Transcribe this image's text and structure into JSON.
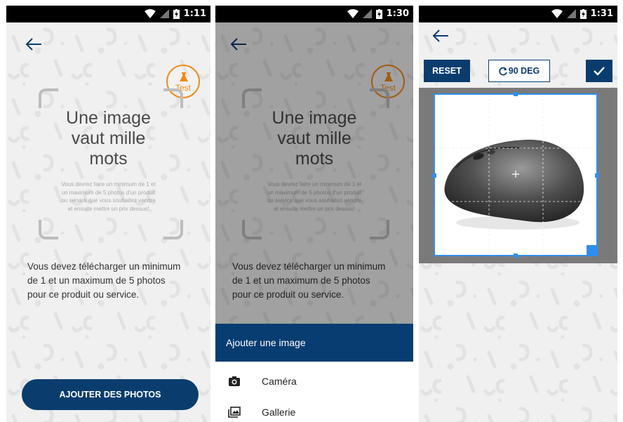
{
  "screen1": {
    "time": "1:11",
    "status_icons": [
      "wifi-icon",
      "signal-icon",
      "battery-icon"
    ],
    "headline": [
      "Une image",
      "vaut mille",
      "mots"
    ],
    "small_text": [
      "Vous devrez faire un minimum de 1 et",
      "un maximum de 5 photos d'un produit",
      "ou service que vous souhaitez vendre",
      "et ensuite mettre un prix dessus!"
    ],
    "test_badge": "Test",
    "instruction": [
      "Vous devez télécharger un minimum",
      "de 1 et un maximum de 5 photos",
      "pour ce produit ou service."
    ],
    "add_button": "AJOUTER DES PHOTOS"
  },
  "screen2": {
    "time": "1:30",
    "headline": [
      "Une image",
      "vaut mille",
      "mots"
    ],
    "small_text": [
      "Vous devrez faire un minimum de 1 et",
      "un maximum de 5 photos d'un produit",
      "ou service que vous souhaitez vendre",
      "et ensuite mettre un prix dessus!"
    ],
    "test_badge": "Test",
    "instruction": [
      "Vous devez télécharger un minimum",
      "de 1 et un maximum de 5 photos",
      "pour ce produit ou service."
    ],
    "sheet_title": "Ajouter une image",
    "sheet_items": [
      {
        "label": "Caméra",
        "icon": "camera-icon"
      },
      {
        "label": "Gallerie",
        "icon": "gallery-icon"
      }
    ]
  },
  "screen3": {
    "time": "1:31",
    "reset_label": "RESET",
    "rotate_label": "90 DEG",
    "confirm_icon": "check-icon",
    "image_subject": "computer-mouse"
  },
  "colors": {
    "primary": "#0a3d6e",
    "accent": "#f28a1a",
    "crop_frame": "#2f8ff0"
  }
}
